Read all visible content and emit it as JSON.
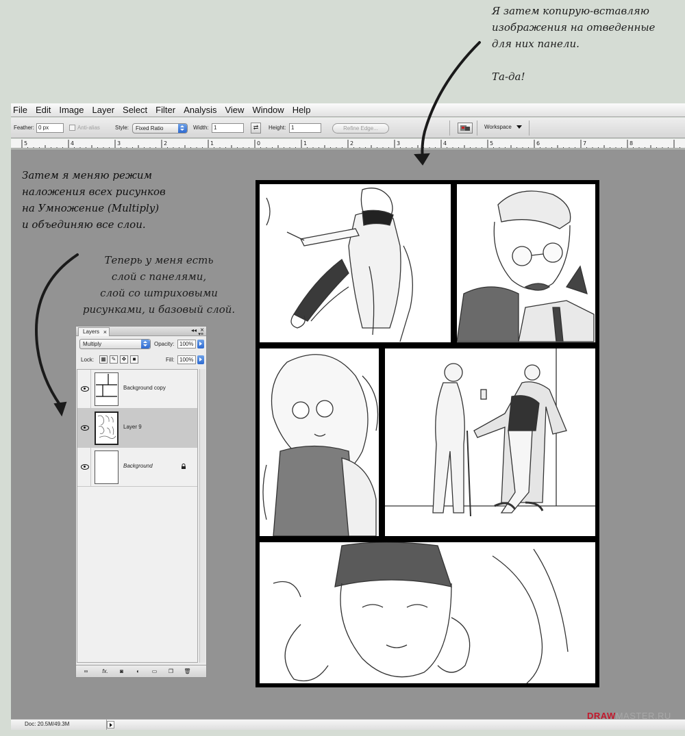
{
  "annotations": {
    "top_right": [
      "Я затем копирую-вставляю",
      "изображения на отведенные",
      "для них панели.",
      "",
      "Та-да!"
    ],
    "left_top": [
      "Затем я меняю режим",
      "наложения всех рисунков",
      "на Умножение (Multiply)",
      "и объединяю все слои."
    ],
    "left_middle": [
      "Теперь у меня есть",
      "слой с панелями,",
      "слой со штриховыми",
      "рисунками, и базовый слой."
    ]
  },
  "menu": [
    "File",
    "Edit",
    "Image",
    "Layer",
    "Select",
    "Filter",
    "Analysis",
    "View",
    "Window",
    "Help"
  ],
  "options": {
    "feather_label": "Feather:",
    "feather_value": "0 px",
    "antialias_label": "Anti-alias",
    "style_label": "Style:",
    "style_value": "Fixed Ratio",
    "width_label": "Width:",
    "width_value": "1",
    "swap_icon": "swap-arrows-icon",
    "height_label": "Height:",
    "height_value": "1",
    "refine_label": "Refine Edge...",
    "workspace_label": "Workspace"
  },
  "ruler_numbers": [
    "5",
    "4",
    "3",
    "2",
    "1",
    "0",
    "1",
    "2",
    "3",
    "4",
    "5",
    "6",
    "7",
    "8"
  ],
  "status": {
    "doc": "Doc: 20.5M/49.3M"
  },
  "layers": {
    "tab": "Layers",
    "blend_mode": "Multiply",
    "opacity_label": "Opacity:",
    "opacity_value": "100%",
    "lock_label": "Lock:",
    "fill_label": "Fill:",
    "fill_value": "100%",
    "items": [
      {
        "name": "Background copy",
        "selected": false,
        "italic": false,
        "locked": false
      },
      {
        "name": "Layer 9",
        "selected": true,
        "italic": false,
        "locked": false
      },
      {
        "name": "Background",
        "selected": false,
        "italic": true,
        "locked": true
      }
    ],
    "footer_icons": [
      "link-icon",
      "fx-icon",
      "mask-icon",
      "adjustment-icon",
      "folder-icon",
      "new-layer-icon",
      "trash-icon"
    ]
  },
  "logo": {
    "text": "DRAWMASTER.RU"
  },
  "colors": {
    "canvas": "#939393",
    "backdrop": "#d5dcd4",
    "accent_blue": "#2d6ad1",
    "logo_red": "#c2182c"
  }
}
